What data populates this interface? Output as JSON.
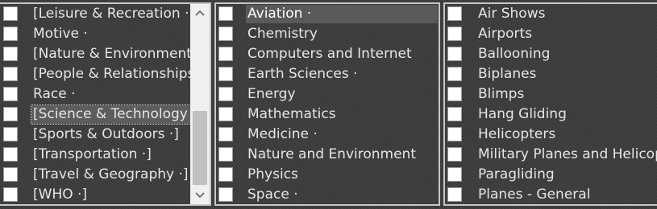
{
  "panel_categories": {
    "items": [
      {
        "label": "[Leisure & Recreation ·]"
      },
      {
        "label": "Motive ·"
      },
      {
        "label": "[Nature & Environment ·]"
      },
      {
        "label": "[People & Relationships ·"
      },
      {
        "label": "Race ·"
      },
      {
        "label": "[Science & Technology ·]"
      },
      {
        "label": "[Sports & Outdoors ·]"
      },
      {
        "label": "[Transportation ·]"
      },
      {
        "label": "[Travel & Geography ·]"
      },
      {
        "label": "[WHO ·]"
      }
    ],
    "selected_index": 5,
    "scroll_up_icon": "chevron-up",
    "scroll_down_icon": "chevron-down"
  },
  "panel_subcategories": {
    "items": [
      {
        "label": "Aviation ·"
      },
      {
        "label": "Chemistry"
      },
      {
        "label": "Computers and Internet"
      },
      {
        "label": "Earth Sciences ·"
      },
      {
        "label": "Energy"
      },
      {
        "label": "Mathematics"
      },
      {
        "label": "Medicine ·"
      },
      {
        "label": "Nature and Environment"
      },
      {
        "label": "Physics"
      },
      {
        "label": "Space ·"
      }
    ],
    "selected_index": 0
  },
  "panel_topics": {
    "items": [
      {
        "label": "Air Shows"
      },
      {
        "label": "Airports"
      },
      {
        "label": "Ballooning"
      },
      {
        "label": "Biplanes"
      },
      {
        "label": "Blimps"
      },
      {
        "label": "Hang Gliding"
      },
      {
        "label": "Helicopters"
      },
      {
        "label": "Military Planes and Helicopters"
      },
      {
        "label": "Paragliding"
      },
      {
        "label": "Planes - General"
      }
    ]
  }
}
